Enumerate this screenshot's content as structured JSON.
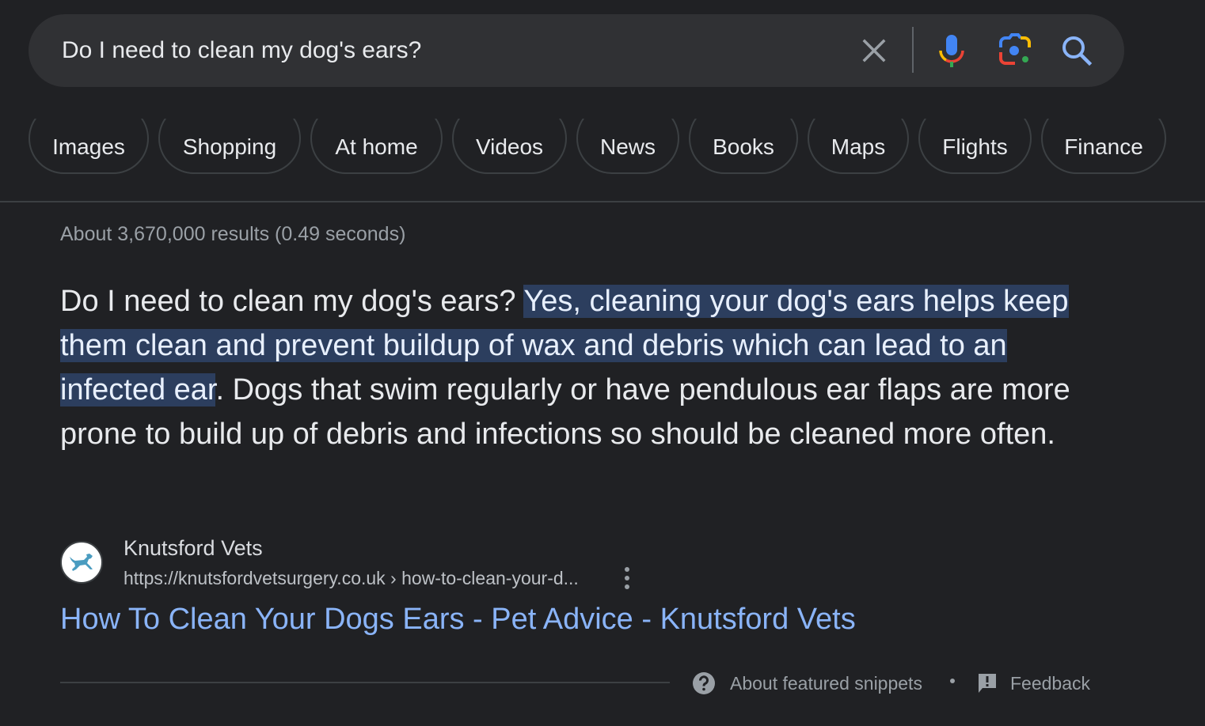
{
  "search": {
    "query": "Do I need to clean my dog's ears?",
    "icons": {
      "clear": "close-icon",
      "voice": "microphone-icon",
      "lens": "camera-lens-icon",
      "search": "search-icon"
    }
  },
  "chips": [
    {
      "label": "Images"
    },
    {
      "label": "Shopping"
    },
    {
      "label": "At home"
    },
    {
      "label": "Videos"
    },
    {
      "label": "News"
    },
    {
      "label": "Books"
    },
    {
      "label": "Maps"
    },
    {
      "label": "Flights"
    },
    {
      "label": "Finance"
    }
  ],
  "results_stats": "About 3,670,000 results (0.49 seconds)",
  "featured_snippet": {
    "lead": "Do I need to clean my dog's ears? ",
    "highlighted": "Yes, cleaning your dog's ears helps keep them clean and prevent buildup of wax and debris which can lead to an infected ear",
    "rest": ". Dogs that swim regularly or have pendulous ear flaps are more prone to build up of debris and infections so should be cleaned more often."
  },
  "source": {
    "site_name": "Knutsford Vets",
    "url": "https://knutsfordvetsurgery.co.uk › how-to-clean-your-d...",
    "favicon": "running-dog-icon",
    "title": "How To Clean Your Dogs Ears - Pet Advice - Knutsford Vets"
  },
  "footer": {
    "about_label": "About featured snippets",
    "feedback_label": "Feedback"
  },
  "colors": {
    "background": "#202124",
    "searchbar": "#303134",
    "link": "#8ab4f8",
    "highlight": "#2c3e5e",
    "muted_text": "#9aa0a6"
  }
}
